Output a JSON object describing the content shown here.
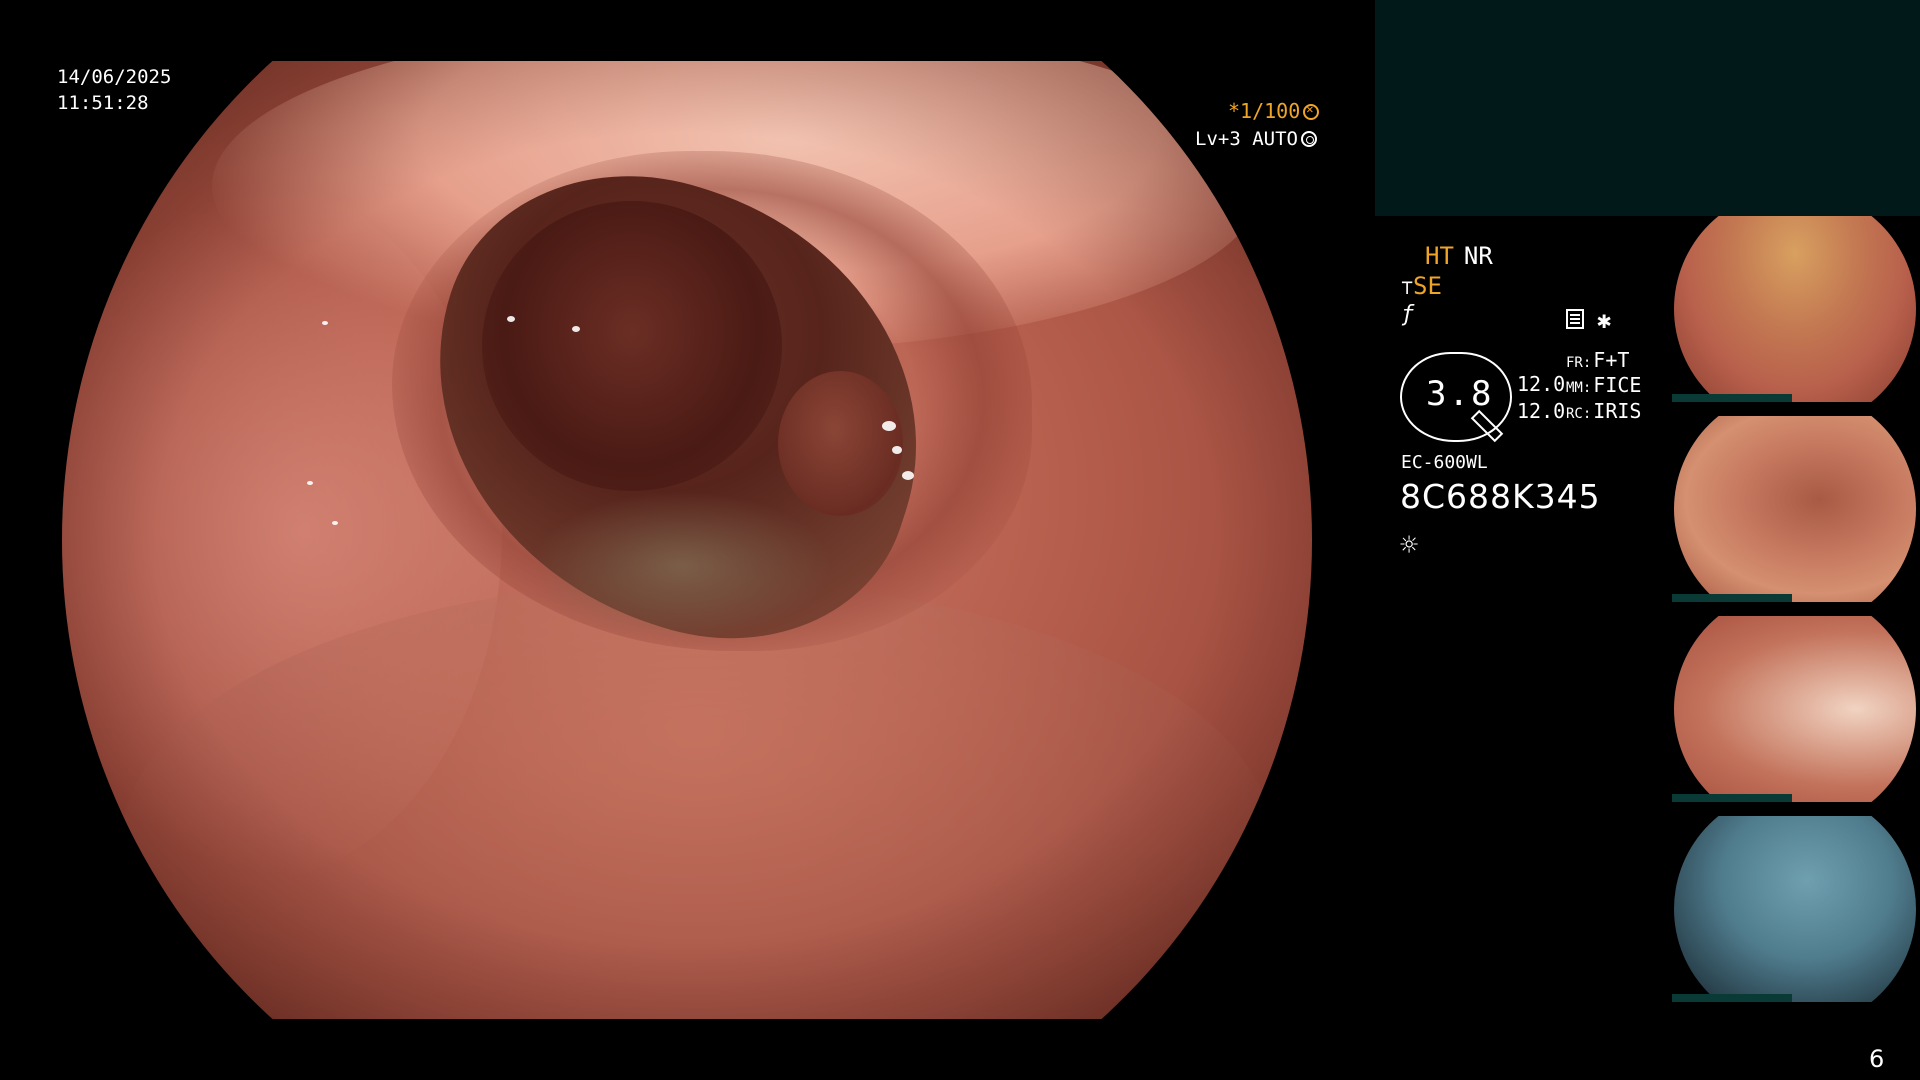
{
  "overlay": {
    "date": "14/06/2025",
    "time": "11:51:28",
    "shutter_speed": "*1/100",
    "light_level": "Lv+3 AUTO"
  },
  "panel": {
    "mode_ht": "HT",
    "mode_nr": "NR",
    "mode_se": "SE",
    "gauge_value": "3.8",
    "value_a": "12.0",
    "value_b": "12.0",
    "fr_key": "FR:",
    "fr_value": "F+T",
    "mm_key": "MM:",
    "mm_value": "FICE",
    "rc_key": "RC:",
    "rc_value": "IRIS",
    "scope_model": "EC-600WL",
    "scope_serial": "8C688K345"
  },
  "thumbnails": [
    {
      "label": "thumbnail-1"
    },
    {
      "label": "thumbnail-2"
    },
    {
      "label": "thumbnail-3"
    },
    {
      "label": "thumbnail-4"
    }
  ],
  "footer": {
    "page_number": "6"
  },
  "icons": {
    "shutter": "shutter-icon",
    "auto_iris": "auto-iris-icon",
    "structure_enhance": "hook-icon",
    "function": "function-icon",
    "document": "document-icon",
    "star": "star-icon",
    "light": "sun-icon"
  },
  "colors": {
    "accent": "#f0a428",
    "panel_bg": "#011a19",
    "background": "#000000"
  }
}
